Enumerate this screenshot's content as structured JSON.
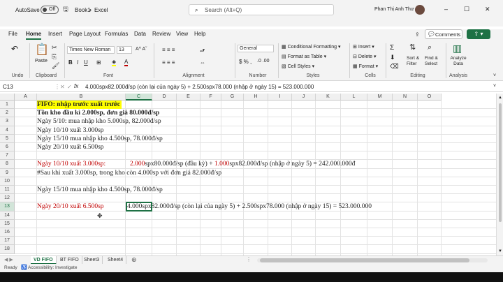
{
  "titlebar": {
    "autosave": "AutoSave",
    "toggle": "Off",
    "filename": "Book1",
    "app": "Excel",
    "search_placeholder": "Search (Alt+Q)",
    "user": "Phan Thị Anh Thư"
  },
  "tabs": [
    "File",
    "Home",
    "Insert",
    "Page Layout",
    "Formulas",
    "Data",
    "Review",
    "View",
    "Help"
  ],
  "tab_active_index": 1,
  "comments_label": "Comments",
  "ribbon": {
    "undo": "Undo",
    "clipboard": "Clipboard",
    "paste": "Paste",
    "font_name": "Times New Roman",
    "font_size": "13",
    "font_group": "Font",
    "alignment": "Alignment",
    "number_format": "General",
    "number_group": "Number",
    "cond_format": "Conditional Formatting",
    "format_table": "Format as Table",
    "cell_styles": "Cell Styles",
    "styles_group": "Styles",
    "insert": "Insert",
    "delete": "Delete",
    "format": "Format",
    "cells_group": "Cells",
    "sort_filter": "Sort & Filter",
    "find_select": "Find & Select",
    "editing_group": "Editing",
    "analyze": "Analyze Data",
    "analysis_group": "Analysis"
  },
  "formula_bar": {
    "name_box": "C13",
    "fx": "fx",
    "content": "4.000spx82.000đ/sp (còn lại của ngày 5) + 2.500spx78.000 (nhập ở ngày 15) = 523.000.000"
  },
  "columns": [
    "A",
    "B",
    "C",
    "D",
    "E",
    "F",
    "G",
    "H",
    "I",
    "J",
    "K",
    "L",
    "M",
    "N",
    "O"
  ],
  "selected_column": "C",
  "rows": [
    "1",
    "2",
    "3",
    "4",
    "5",
    "6",
    "7",
    "8",
    "9",
    "10",
    "11",
    "12",
    "13",
    "14",
    "15",
    "16",
    "17",
    "18"
  ],
  "selected_row": "13",
  "cells": {
    "r1": "FIFO: nhập trước xuất trước",
    "r2": "Tồn kho đầu kì 2.000sp, đơn giá 80.000đ/sp",
    "r3": "Ngày 5/10: mua nhập kho 5.000sp, 82.000đ/sp",
    "r4": "Ngày 10/10 xuất 3.000sp",
    "r5": "Ngày 15/10 mua nhập kho 4.500sp, 78.000đ/sp",
    "r6": "Ngày 20/10 xuất 6.500sp",
    "r8_b": "Ngày 10/10 xuất 3.000sp:",
    "r8_c1": "2.000",
    "r8_c2": "spx80.000đ/sp (đầu kỳ) + ",
    "r8_c3": "1.000",
    "r8_c4": "spx82.000đ/sp (nhập ở ngày 5) = 242.000.000đ",
    "r9": "#Sau khi xuất 3.000sp, trong kho còn 4.000sp với đơn giá 82.000đ/sp",
    "r11": "Ngày 15/10 mua nhập kho 4.500sp, 78.000đ/sp",
    "r13_b": "Ngày 20/10 xuất 6.500sp",
    "r13_c": "4.000spx82.000đ/sp (còn lại của ngày 5) + 2.500spx78.000 (nhập ở ngày 15) = 523.000.000"
  },
  "sheets": [
    "VD FIFO",
    "BT FIFO",
    "Sheet3",
    "Sheet4"
  ],
  "sheet_active_index": 0,
  "status": {
    "ready": "Ready",
    "accessibility": "Accessibility: Investigate"
  },
  "colors": {
    "accent": "#1e7145",
    "red_text": "#c00000",
    "highlight": "#ffff00"
  }
}
